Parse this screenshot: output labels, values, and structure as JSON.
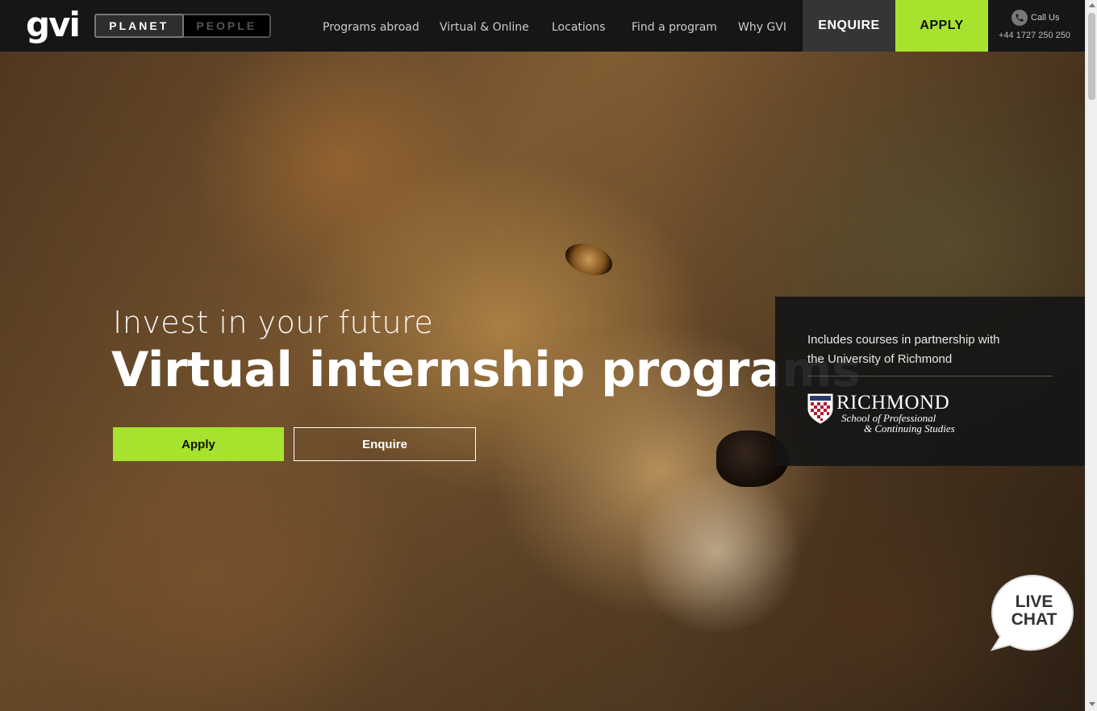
{
  "nav": {
    "logo": "gvi",
    "toggle": {
      "planet": "PLANET",
      "people": "PEOPLE"
    },
    "links": [
      "Programs abroad",
      "Virtual & Online",
      "Locations",
      "Find a program",
      "Why GVI"
    ],
    "enquire": "ENQUIRE",
    "apply": "APPLY",
    "call_label": "Call Us",
    "phone": "+44 1727 250 250"
  },
  "hero": {
    "kicker": "Invest in your future",
    "headline": "Virtual internship programs",
    "apply": "Apply",
    "enquire": "Enquire"
  },
  "partner": {
    "text": "Includes courses in partnership with the University of Richmond",
    "logo_name": "RICHMOND",
    "logo_sub1": "School of Professional",
    "logo_sub2": "& Continuing Studies"
  },
  "live_chat": "LIVE CHAT",
  "colors": {
    "accent": "#a6e22e",
    "nav_bg": "#161616"
  }
}
